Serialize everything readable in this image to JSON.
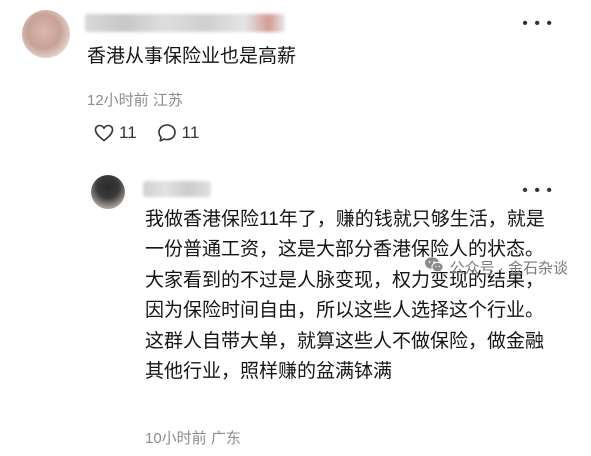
{
  "comments": [
    {
      "text": "香港从事保险业也是高薪",
      "time": "12小时前",
      "location": "江苏",
      "likes": "11",
      "replies": "11"
    },
    {
      "text": "我做香港保险11年了，赚的钱就只够生活，就是一份普通工资，这是大部分香港保险人的状态。大家看到的不过是人脉变现，权力变现的结果，因为保险时间自由，所以这些人选择这个行业。这群人自带大单，就算这些人不做保险，做金融其他行业，照样赚的盆满钵满",
      "time": "10小时前",
      "location": "广东"
    }
  ],
  "watermark": {
    "text": "公众号 · 金石杂谈",
    "icon": "wechat-icon"
  },
  "icons": {
    "like": "heart-icon",
    "reply": "speech-bubble-icon",
    "more": "more-dots-icon"
  },
  "colors": {
    "text": "#151515",
    "meta": "#8c8c8c",
    "icon": "#333333"
  }
}
